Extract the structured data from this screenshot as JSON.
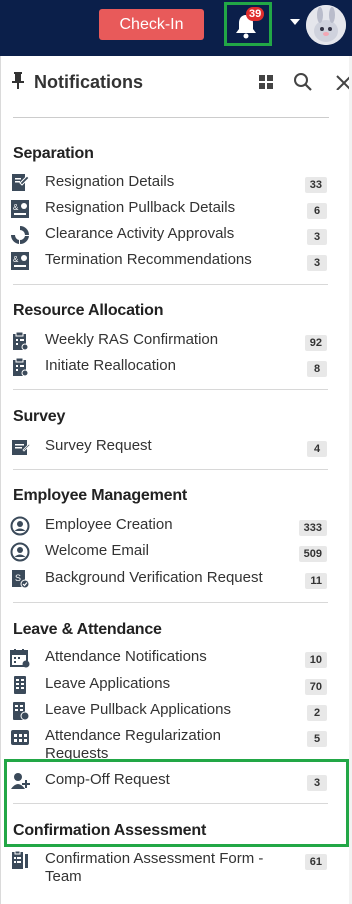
{
  "header": {
    "checkin_label": "Check-In",
    "notification_count": "39"
  },
  "panel": {
    "title": "Notifications"
  },
  "sections": [
    {
      "title": "Separation",
      "items": [
        {
          "label": "Resignation Details",
          "count": "33",
          "icon": "resignation-icon"
        },
        {
          "label": "Resignation Pullback Details",
          "count": "6",
          "icon": "pullback-icon"
        },
        {
          "label": "Clearance Activity Approvals",
          "count": "3",
          "icon": "clearance-icon"
        },
        {
          "label": "Termination Recommendations",
          "count": "3",
          "icon": "termination-icon"
        }
      ]
    },
    {
      "title": "Resource Allocation",
      "items": [
        {
          "label": "Weekly RAS Confirmation",
          "count": "92",
          "icon": "clipboard-icon"
        },
        {
          "label": "Initiate Reallocation",
          "count": "8",
          "icon": "clipboard-icon"
        }
      ]
    },
    {
      "title": "Survey",
      "items": [
        {
          "label": "Survey Request",
          "count": "4",
          "icon": "survey-icon"
        }
      ]
    },
    {
      "title": "Employee Management",
      "items": [
        {
          "label": "Employee Creation",
          "count": "333",
          "icon": "employee-icon"
        },
        {
          "label": "Welcome Email",
          "count": "509",
          "icon": "email-icon"
        },
        {
          "label": "Background Verification Request",
          "count": "11",
          "icon": "verification-icon"
        }
      ]
    },
    {
      "title": "Leave & Attendance",
      "items": [
        {
          "label": "Attendance Notifications",
          "count": "10",
          "icon": "calendar-icon"
        },
        {
          "label": "Leave Applications",
          "count": "70",
          "icon": "leave-icon"
        },
        {
          "label": "Leave Pullback Applications",
          "count": "2",
          "icon": "leave-pullback-icon"
        },
        {
          "label": "Attendance Regularization Requests",
          "count": "5",
          "icon": "regularization-icon"
        },
        {
          "label": "Comp-Off Request",
          "count": "3",
          "icon": "compoff-icon"
        }
      ]
    },
    {
      "title": "Confirmation Assessment",
      "items": [
        {
          "label": "Confirmation Assessment Form - Team",
          "count": "61",
          "icon": "assessment-icon"
        }
      ]
    }
  ]
}
